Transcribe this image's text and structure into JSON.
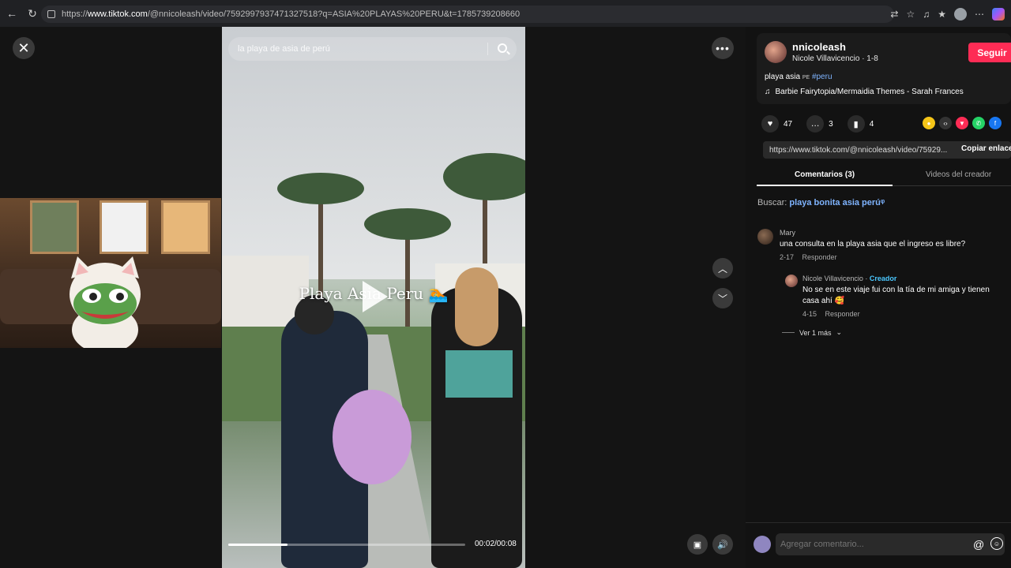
{
  "browser": {
    "url_prefix": "https://",
    "url_host": "www.tiktok.com",
    "url_path": "/@nnicoleash/video/7592997937471327518?q=ASIA%20PLAYAS%20PERU&t=1785739208660"
  },
  "video": {
    "search_placeholder": "la playa de asia de perú",
    "caption": "Playa Asia Peru 🏊",
    "progress": 0.25,
    "time": "00:02/00:08"
  },
  "author": {
    "username": "nnicoleash",
    "subline": "Nicole Villavicencio · 1-8",
    "follow_label": "Seguir",
    "desc_text": "playa asia",
    "desc_flag": "PE",
    "desc_tag": "#peru",
    "music": "Barbie Fairytopia/Mermaidia Themes - Sarah Frances"
  },
  "stats": {
    "likes": "47",
    "comments": "3",
    "saves": "4"
  },
  "share_link": {
    "url": "https://www.tiktok.com/@nnicoleash/video/75929...",
    "copy_label": "Copiar enlace"
  },
  "tabs": {
    "comments": "Comentarios (3)",
    "videos": "Videos del creador"
  },
  "search_suggest": {
    "label": "Buscar:",
    "query": "playa bonita asia perú"
  },
  "comments": [
    {
      "name": "Mary",
      "text": "una consulta en la playa asia que el ingreso es libre?",
      "date": "2-17",
      "reply": "Responder"
    },
    {
      "name": "Nicole Villavicencio",
      "creator": "Creador",
      "text": "No se en este viaje fui con la tía de mi amiga y tienen casa ahí 🥰",
      "date": "4-15",
      "reply": "Responder"
    }
  ],
  "view_more": "Ver 1 más",
  "comment_box": {
    "placeholder": "Agregar comentario..."
  },
  "colors": {
    "follow": "#fe2c55",
    "link": "#7fb4ff",
    "creator": "#4bc8ff"
  }
}
